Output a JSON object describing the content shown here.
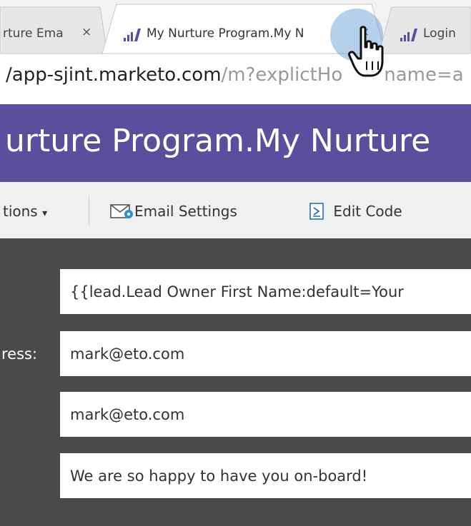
{
  "browser": {
    "tabs": [
      {
        "label": "rture Ema",
        "close": "×"
      },
      {
        "label": "My Nurture Program.My N",
        "close": "×"
      },
      {
        "label": "Login",
        "close": "×"
      }
    ],
    "url_host": "/app-sjint.marketo.com",
    "url_path": "/m?explictHo",
    "url_tail": "name=a"
  },
  "banner": {
    "title": "urture Program.My Nurture"
  },
  "toolbar": {
    "actions_label": "tions",
    "actions_caret": "▾",
    "email_settings_label": "Email Settings",
    "edit_code_label": "Edit Code"
  },
  "form": {
    "from_name_value": "{{lead.Lead Owner First Name:default=Your",
    "from_address_label": "ress:",
    "from_address_value": "mark@eto.com",
    "reply_to_value": "mark@eto.com",
    "subject_value": "We are so happy to have you on-board!"
  },
  "icons": {
    "tab_favicon": "marketo-bars-icon",
    "email_settings": "email-gear-icon",
    "edit_code": "code-file-icon",
    "cursor": "hand-pointer-icon"
  },
  "colors": {
    "banner": "#5a4f9c",
    "panel": "#4a4a4a",
    "toolbar": "#f0f0f0",
    "favicon": "#5a4f9c"
  }
}
